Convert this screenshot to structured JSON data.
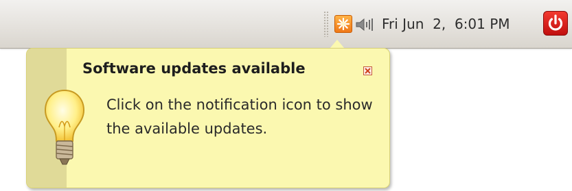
{
  "panel": {
    "clock_text": "Fri Jun  2,  6:01 PM",
    "icons": {
      "notification": "update-notification-icon",
      "volume": "volume-icon",
      "power": "power-icon"
    }
  },
  "notification": {
    "title": "Software updates available",
    "body": "Click on the notification icon to show the available updates.",
    "icon": "lightbulb-icon",
    "close": "close-icon"
  },
  "colors": {
    "bubble_bg": "#fbf8b0",
    "bubble_stripe": "#e0da98",
    "power_red": "#d51a15",
    "notif_orange": "#f07818"
  }
}
